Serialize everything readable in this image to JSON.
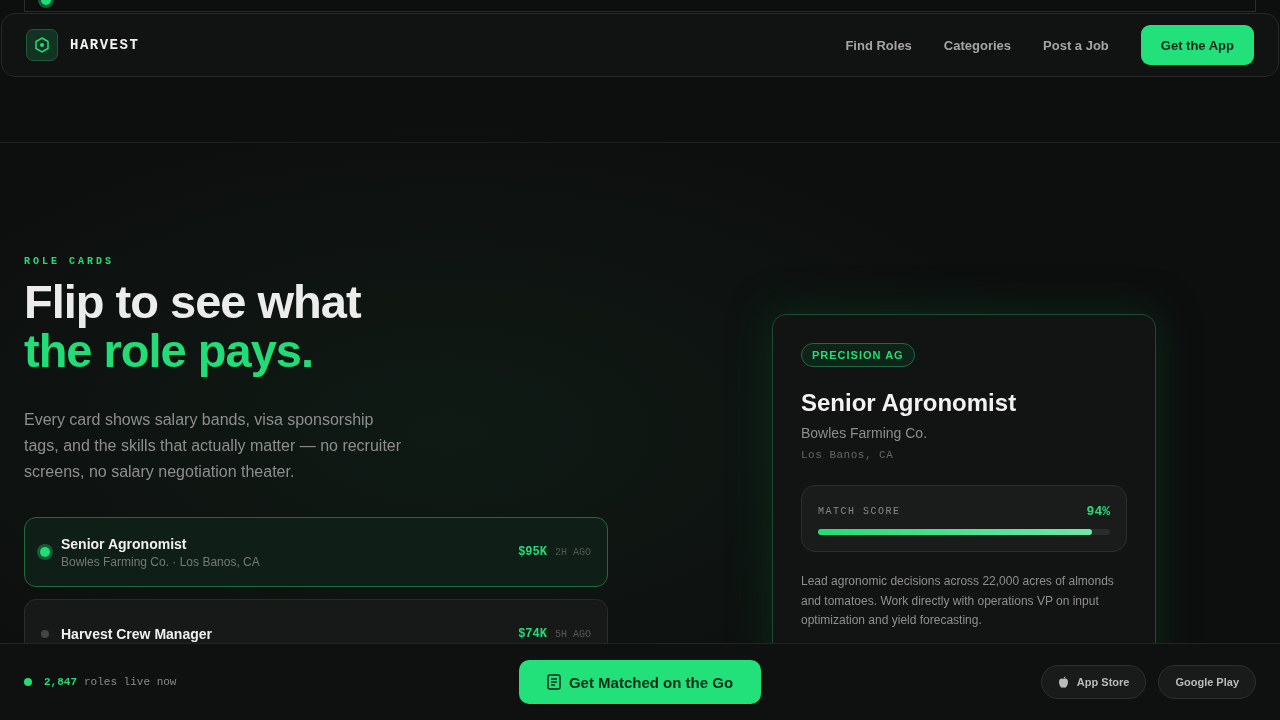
{
  "nav": {
    "brand": "HARVEST",
    "links": [
      "Find Roles",
      "Categories",
      "Post a Job"
    ],
    "cta": "Get the App"
  },
  "hero": {
    "eyebrow": "ROLE CARDS",
    "title_line_1": "Flip to see what",
    "title_line_2": "the role pays.",
    "description": "Every card shows salary bands, visa sponsorship tags, and the skills that actually matter — no recruiter screens, no salary negotiation theater."
  },
  "roles": [
    {
      "title": "Senior Agronomist",
      "subtitle": "Bowles Farming Co. · Los Banos, CA",
      "salary": "$95K",
      "age": "2H AGO",
      "selected": true
    },
    {
      "title": "Harvest Crew Manager",
      "salary": "$74K",
      "age": "5H AGO",
      "selected": false
    }
  ],
  "card": {
    "tag": "PRECISION AG",
    "title": "Senior Agronomist",
    "company": "Bowles Farming Co.",
    "location": "Los Banos, CA",
    "match_label": "MATCH SCORE",
    "match_value": "94%",
    "level": 0.94,
    "description": "Lead agronomic decisions across 22,000 acres of almonds and tomatoes. Work directly with operations VP on input optimization and yield forecasting."
  },
  "footer": {
    "count": "2,847",
    "count_label": "roles live now",
    "cta": "Get Matched on the Go",
    "stores": [
      "App Store",
      "Google Play"
    ]
  }
}
